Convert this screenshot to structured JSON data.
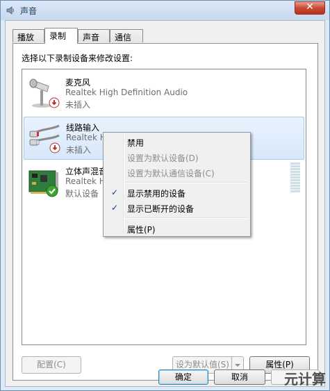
{
  "window": {
    "title": "声音",
    "close_label": "✕"
  },
  "tabs": [
    {
      "label": "播放"
    },
    {
      "label": "录制"
    },
    {
      "label": "声音"
    },
    {
      "label": "通信"
    }
  ],
  "panel": {
    "instruction": "选择以下录制设备来修改设置:"
  },
  "devices": [
    {
      "name": "麦克风",
      "driver": "Realtek High Definition Audio",
      "status": "未插入",
      "icon": "microphone-icon",
      "badge": "unplugged-badge-icon"
    },
    {
      "name": "线路输入",
      "driver": "Realtek H",
      "status": "未插入",
      "icon": "line-in-jack-icon",
      "badge": "unplugged-badge-icon"
    },
    {
      "name": "立体声混音",
      "driver": "Realtek H",
      "status": "默认设备",
      "icon": "sound-card-icon",
      "badge": "default-check-badge-icon"
    }
  ],
  "context_menu": {
    "items": [
      {
        "label": "禁用",
        "checked": false,
        "disabled": false
      },
      {
        "label": "设置为默认设备(D)",
        "checked": false,
        "disabled": true
      },
      {
        "label": "设置为默认通信设备(C)",
        "checked": false,
        "disabled": true
      },
      {
        "label": "显示禁用的设备",
        "checked": true,
        "disabled": false
      },
      {
        "label": "显示已断开的设备",
        "checked": true,
        "disabled": false
      },
      {
        "label": "属性(P)",
        "checked": false,
        "disabled": false
      }
    ]
  },
  "buttons": {
    "configure": "配置(C)",
    "set_default": "设为默认值(S)",
    "properties": "属性(P)",
    "ok": "确定",
    "cancel": "取消"
  },
  "watermark": "元计算",
  "colors": {
    "selection": "#d6e8fb",
    "check": "#0b3d91",
    "close": "#c84a33"
  }
}
